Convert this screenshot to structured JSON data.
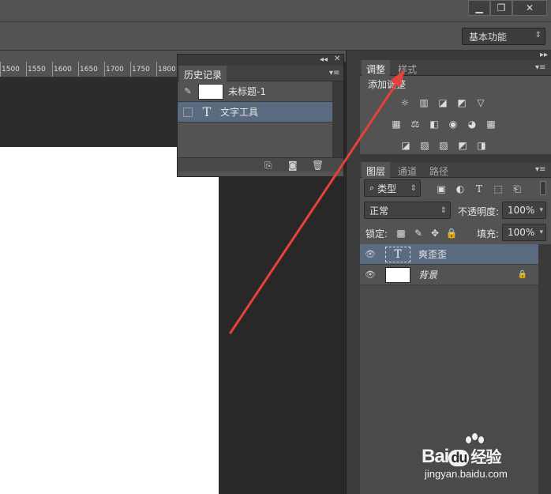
{
  "window": {
    "min_icon": "minimize-icon",
    "max_icon": "restore-icon",
    "close_icon": "close-icon"
  },
  "options_bar": {
    "workspace": "基本功能"
  },
  "ruler": {
    "labels": [
      "1500",
      "1550",
      "1600",
      "1650",
      "1700",
      "1750",
      "1800"
    ]
  },
  "history": {
    "tab": "历史记录",
    "snapshot_label": "未标题-1",
    "state_label": "文字工具",
    "state_icon": "T"
  },
  "adjustments": {
    "tab_adjust": "调整",
    "tab_styles": "样式",
    "add_label": "添加调整",
    "row1": [
      "☼",
      "▥",
      "◪",
      "◩",
      "▽"
    ],
    "row2": [
      "▦",
      "⚖",
      "◧",
      "◉",
      "◕",
      "▦"
    ],
    "row3": [
      "◪",
      "▨",
      "▨",
      "◩",
      "◨"
    ]
  },
  "layers": {
    "tab_layers": "图层",
    "tab_channels": "通道",
    "tab_paths": "路径",
    "filter_kind": "类型",
    "blend_mode": "正常",
    "opacity_label": "不透明度:",
    "opacity_value": "100%",
    "lock_label": "锁定:",
    "fill_label": "填充:",
    "fill_value": "100%",
    "items": [
      {
        "name": "爽歪歪",
        "type_glyph": "T"
      },
      {
        "name": "背景"
      }
    ]
  },
  "colors": {
    "selected_row": "#5a6a80",
    "panel_bg": "#535353",
    "annotation_arrow": "#e8403a"
  },
  "watermark": {
    "brand_a": "Bai",
    "brand_b": "du",
    "brand_c": "经验",
    "url": "jingyan.baidu.com"
  }
}
